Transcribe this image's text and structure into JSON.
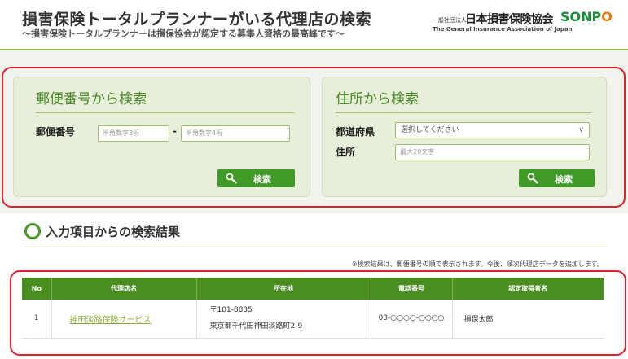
{
  "header": {
    "title": "損害保険トータルプランナーがいる代理店の検索",
    "subtitle": "〜損害保険トータルプランナーは損保協会が認定する募集人資格の最高峰です〜",
    "logo_small": "一般社団法人",
    "logo_main": "日本損害保険協会",
    "logo_sonpo_pre": "SONP",
    "logo_sonpo_o": "O",
    "logo_en": "The General Insurance Association of Japan"
  },
  "postal_search": {
    "title": "郵便番号から検索",
    "label": "郵便番号",
    "first_placeholder": "半角数字3桁",
    "separator": "-",
    "second_placeholder": "半角数字4桁",
    "button_label": "検索"
  },
  "address_search": {
    "title": "住所から検索",
    "prefecture_label": "都道府県",
    "prefecture_selected": "選択してください",
    "address_label": "住所",
    "address_placeholder": "最大20文字",
    "button_label": "検索"
  },
  "results": {
    "title": "入力項目からの検索結果",
    "note": "※検索結果は、郵便番号の順で表示されます。今後、順次代理店データを追加します。",
    "columns": [
      "No",
      "代理店名",
      "所在地",
      "電話番号",
      "認定取得者名"
    ],
    "rows": [
      {
        "no": "1",
        "agency": "神田淡路保険サービス",
        "postal": "〒101-8835",
        "address": "東京都千代田神田淡路町2-9",
        "tel": "03-○○○○-○○○○",
        "person": "損保太郎"
      }
    ]
  },
  "colors": {
    "brand_green": "#3f9a28",
    "accent_orange": "#e8780a",
    "highlight_red": "#e0202c",
    "panel_bg": "#e7efd9"
  }
}
